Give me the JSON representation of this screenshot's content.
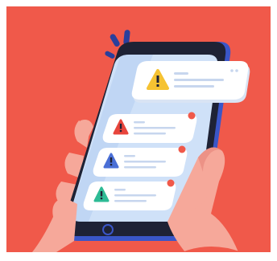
{
  "illustration": {
    "colors": {
      "background": "#f0594a",
      "phone_body": "#1e2235",
      "phone_side": "#3a56c8",
      "screen": "#cfe1f8",
      "screen_shade": "#b9d2f2",
      "card": "#ffffff",
      "card_shadow": "#d9e4f4",
      "skin": "#f6a89a",
      "skin_shadow": "#e6837a",
      "sleeve": "#f0594a",
      "dot_red": "#f0594a"
    },
    "notifications": [
      {
        "icon": "warning-icon",
        "color": "#f5c232",
        "mark": "!"
      },
      {
        "icon": "warning-icon",
        "color": "#e8453c",
        "mark": "!"
      },
      {
        "icon": "warning-icon",
        "color": "#4a6fd6",
        "mark": "!"
      },
      {
        "icon": "warning-icon",
        "color": "#2dbb95",
        "mark": "!"
      }
    ]
  }
}
